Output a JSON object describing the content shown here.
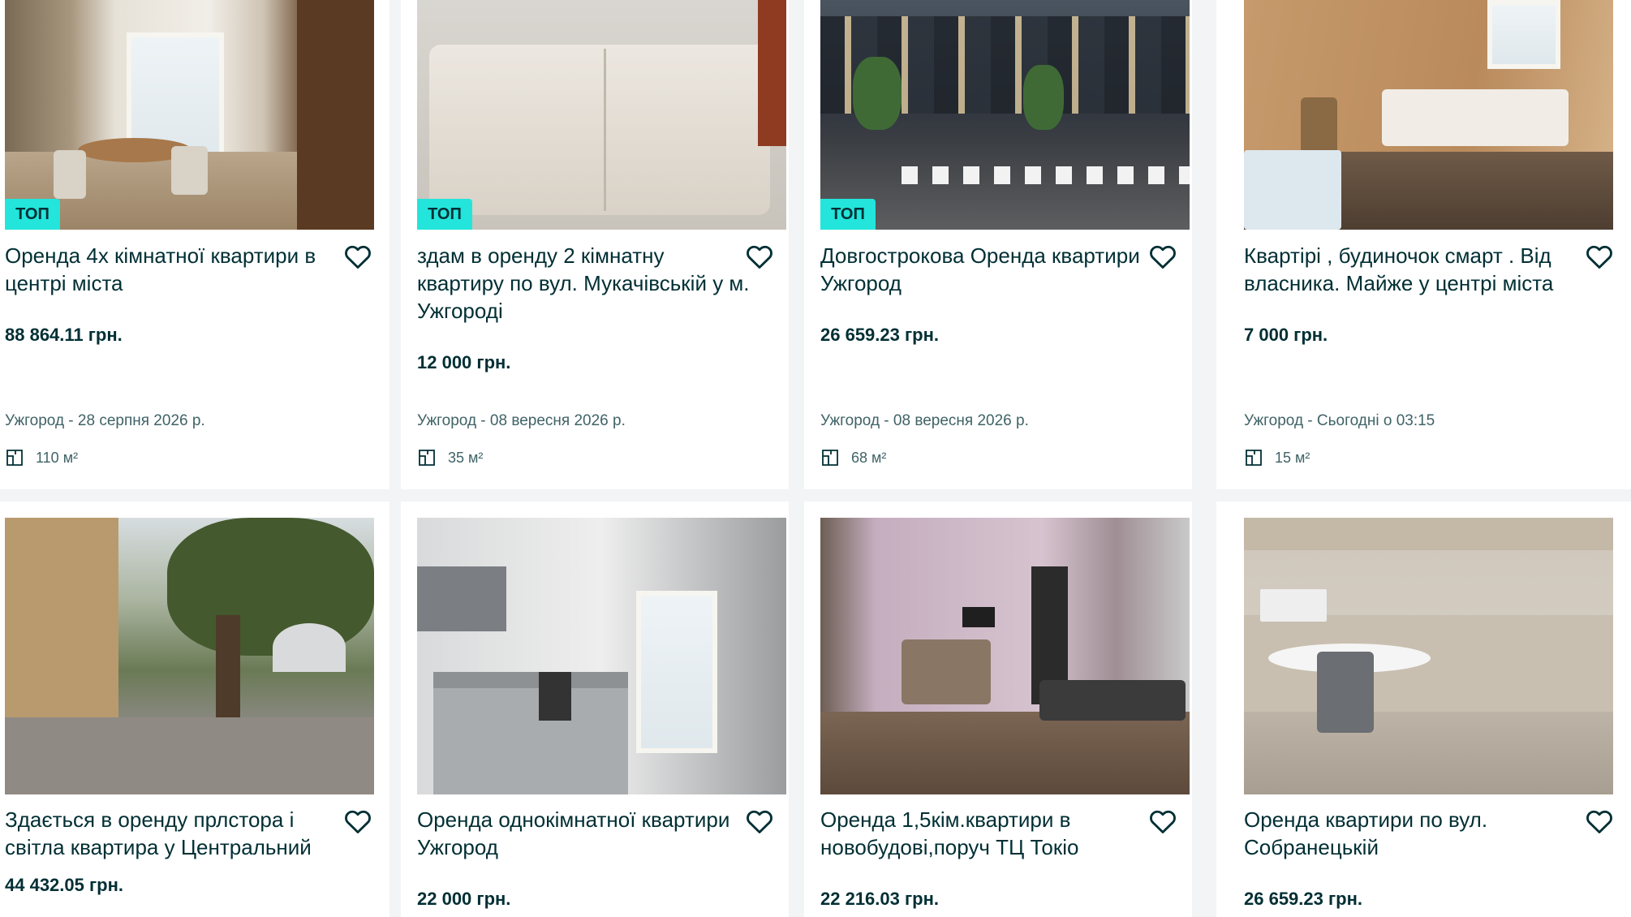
{
  "badge_label": "ТОП",
  "colors": {
    "badge": "#23e5db",
    "text": "#002f34",
    "muted": "#406367",
    "background": "#f2f4f5"
  },
  "icons": {
    "favorite": "heart-outline-icon",
    "area": "floor-plan-icon"
  },
  "listings": [
    {
      "title": "Оренда 4х кімнатної квартири в центрі міста",
      "price": "88 864.11 грн.",
      "location_date": "Ужгород - 28 серпня 2026 р.",
      "area": "110 м²",
      "top": true
    },
    {
      "title": "здам в оренду 2 кімнатну квартиру по вул. Мукачівській у м. Ужгороді",
      "price": "12 000 грн.",
      "location_date": "Ужгород - 08 вересня 2026 р.",
      "area": "35 м²",
      "top": true
    },
    {
      "title": "Довгострокова Оренда квартири Ужгород",
      "price": "26 659.23 грн.",
      "location_date": "Ужгород - 08 вересня 2026 р.",
      "area": "68 м²",
      "top": true
    },
    {
      "title": "Квартірі , будиночок смарт . Від власника. Майже у центрі міста",
      "price": "7 000 грн.",
      "location_date": "Ужгород - Сьогодні о 03:15",
      "area": "15 м²",
      "top": false
    },
    {
      "title": "Здається в оренду прлстора і світла квартира у Центральний",
      "price": "44 432.05 грн.",
      "top": false
    },
    {
      "title": "Оренда однокімнатної квартири Ужгород",
      "price": "22 000 грн.",
      "top": false
    },
    {
      "title": "Оренда 1,5кім.квартири в новобудові,поруч ТЦ Токіо",
      "price": "22 216.03 грн.",
      "top": false
    },
    {
      "title": "Оренда квартири по вул. Собранецькій",
      "price": "26 659.23 грн.",
      "top": false
    }
  ]
}
